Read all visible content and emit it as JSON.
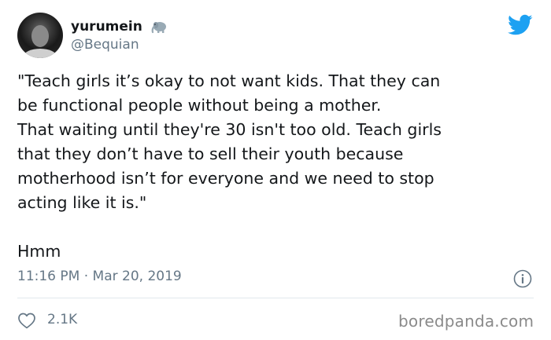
{
  "author": {
    "display_name": "yurumein",
    "handle": "@Bequian",
    "badge_icon": "elephant-emoji-icon"
  },
  "brand": {
    "logo_icon": "twitter-bird-icon",
    "color": "#1da1f2"
  },
  "tweet": {
    "lines": [
      "\"Teach girls it’s okay to not want kids. That they can",
      "be functional people without being a mother.",
      "That waiting until they're 30 isn't too old. Teach girls",
      "that they don’t have to sell their youth because",
      "motherhood isn’t for everyone and we need to stop",
      "acting like it is.\"",
      "Hmm"
    ],
    "timestamp": "11:16 PM · Mar 20, 2019"
  },
  "actions": {
    "like_icon": "heart-icon",
    "like_count": "2.1K",
    "info_icon": "info-icon"
  },
  "watermark": "boredpanda.com",
  "colors": {
    "text": "#14171a",
    "secondary_text": "#657786",
    "divider": "#e1e8ed"
  }
}
